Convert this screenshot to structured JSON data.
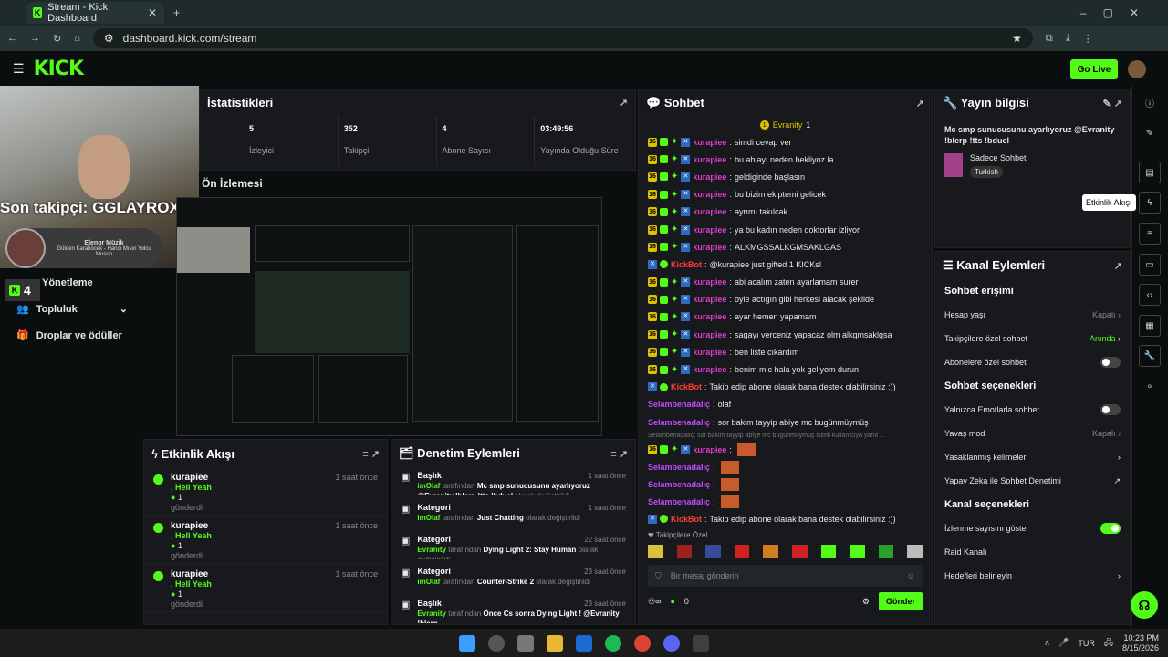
{
  "browser": {
    "tab_title": "Stream - Kick Dashboard",
    "url": "dashboard.kick.com/stream"
  },
  "header": {
    "logo": "KICK",
    "go_live": "Go Live"
  },
  "overlay": {
    "last_follower": "Son takipçi: GGLAYROX",
    "music_title": "Elenor Müzik",
    "music_artist": "Gülden Karaböcek - Hancı Mısın Yolcu Musun",
    "viewers": "4"
  },
  "sidebar": {
    "items": [
      {
        "label": "Yönetleme"
      },
      {
        "label": "Topluluk"
      },
      {
        "label": "Droplar ve ödüller"
      }
    ]
  },
  "stats": {
    "title": "İstatistikleri",
    "items": [
      {
        "value": "5",
        "label": "İzleyici"
      },
      {
        "value": "352",
        "label": "Takipçi"
      },
      {
        "value": "4",
        "label": "Abone Sayısı"
      },
      {
        "value": "03:49:56",
        "label": "Yayında Olduğu Süre"
      }
    ]
  },
  "preview": {
    "title": "Ön İzlemesi"
  },
  "chat": {
    "title": "Sohbet",
    "pinned_user": "Evranity",
    "pinned_count": "1",
    "lines": [
      {
        "user": "kurapiee",
        "text": "simdi cevap ver",
        "badges": true
      },
      {
        "user": "kurapiee",
        "text": "bu ablayı neden bekliyoz la",
        "badges": true
      },
      {
        "user": "kurapiee",
        "text": "geldiginde başlasın",
        "badges": true
      },
      {
        "user": "kurapiee",
        "text": "bu bizim ekiptemi gelicek",
        "badges": true
      },
      {
        "user": "kurapiee",
        "text": "ayrımı takılcak",
        "badges": true
      },
      {
        "user": "kurapiee",
        "text": "ya bu kadın neden doktorlar izliyor",
        "badges": true
      },
      {
        "user": "kurapiee",
        "text": "ALKMGSSALKGMSAKLGAS",
        "badges": true
      },
      {
        "user": "KickBot",
        "text": "@kurapiee just gifted 1 KICKs!",
        "badges": false
      },
      {
        "user": "kurapiee",
        "text": "abi acalım zaten ayarlamam surer",
        "badges": true
      },
      {
        "user": "kurapiee",
        "text": "oyle actıgın gibi herkesi alacak şekilde",
        "badges": true
      },
      {
        "user": "kurapiee",
        "text": "ayar hemen yapamam",
        "badges": true
      },
      {
        "user": "kurapiee",
        "text": "sagayı verceniz yapacaz olm alkgmsaklgsa",
        "badges": true
      },
      {
        "user": "kurapiee",
        "text": "ben liste cıkardım",
        "badges": true
      },
      {
        "user": "kurapiee",
        "text": "benim mic hala yok geliyom durun",
        "badges": true
      },
      {
        "user": "KickBot",
        "text": "Takip edip abone olarak bana destek olabilirsiniz :))",
        "badges": false
      },
      {
        "user": "Selambenadalıç",
        "text": "olaf",
        "badges": false
      },
      {
        "user": "Selambenadalıç",
        "text": "sor bakim tayyip abiye mc bugünmüymüş",
        "badges": false
      }
    ],
    "reply_hint": "Selambenadalıç: sor bakim tayyip abiye mc bugünmüymüş isimli kullanıcıya yanıt ...",
    "lines2": [
      {
        "user": "kurapiee",
        "text": "",
        "badges": true
      },
      {
        "user": "Selambenadalıç",
        "text": "",
        "badges": false
      },
      {
        "user": "Selambenadalıç",
        "text": "",
        "badges": false
      },
      {
        "user": "Selambenadalıç",
        "text": "",
        "badges": false
      },
      {
        "user": "KickBot",
        "text": "Takip edip abone olarak bana destek olabilirsiniz :))",
        "badges": false
      }
    ],
    "followers_only": "Takipçilere Özel",
    "placeholder": "Bir mesaj gönderin",
    "count": "0",
    "send": "Gönder"
  },
  "stream_info": {
    "title": "Yayın bilgisi",
    "stream_title": "Mc smp sunucusunu ayarlıyoruz @Evranity !blerp !tts !bduel",
    "category": "Sadece Sohbet",
    "tag": "Turkish"
  },
  "channel_actions": {
    "title": "Kanal Eylemleri",
    "chat_access": "Sohbet erişimi",
    "account_age": "Hesap yaşı",
    "account_age_value": "Kapalı",
    "followers_only": "Takipçilere özel sohbet",
    "followers_only_value": "Anında",
    "subs_only": "Abonelere özel sohbet",
    "chat_options": "Sohbet seçenekleri",
    "emote_only": "Yalnızca Emotlarla sohbet",
    "slow_mode": "Yavaş mod",
    "slow_mode_value": "Kapalı",
    "banned_words": "Yasaklanmış kelimeler",
    "ai_mod": "Yapay Zeka ile Sohbet Denetimi",
    "channel_options": "Kanal seçenekleri",
    "show_viewers": "İzlenme sayısını göster",
    "raid": "Raid Kanalı",
    "goals": "Hedefleri belirleyin"
  },
  "tooltip": "Etkinlik Akışı",
  "activity": {
    "title": "Etkinlik Akışı",
    "items": [
      {
        "user": "kurapiee",
        "msg": ", Hell Yeah",
        "amount": "1",
        "verb": "gönderdi",
        "time": "1 saat önce"
      },
      {
        "user": "kurapiee",
        "msg": ", Hell Yeah",
        "amount": "1",
        "verb": "gönderdi",
        "time": "1 saat önce"
      },
      {
        "user": "kurapiee",
        "msg": ", Hell Yeah",
        "amount": "1",
        "verb": "gönderdi",
        "time": "1 saat önce"
      }
    ]
  },
  "moderation": {
    "title": "Denetim Eylemleri",
    "items": [
      {
        "type": "Başlık",
        "time": "1 saat önce",
        "actor": "imOlaf",
        "by": "tarafından",
        "value": "Mc smp sunucusunu ayarlıyoruz @Evranity !blerp !tts !bduel",
        "suffix": "olarak değiştirildi"
      },
      {
        "type": "Kategori",
        "time": "1 saat önce",
        "actor": "imOlaf",
        "by": "tarafından",
        "value": "Just Chatting",
        "suffix": "olarak değiştirildi"
      },
      {
        "type": "Kategori",
        "time": "22 saat önce",
        "actor": "Evranity",
        "by": "tarafından",
        "value": "Dying Light 2: Stay Human",
        "suffix": "olarak değiştirildi"
      },
      {
        "type": "Kategori",
        "time": "23 saat önce",
        "actor": "imOlaf",
        "by": "tarafından",
        "value": "Counter-Strike 2",
        "suffix": "olarak değiştirildi"
      },
      {
        "type": "Başlık",
        "time": "23 saat önce",
        "actor": "Evranity",
        "by": "tarafından",
        "value": "Önce Cs sonra Dying Light ! @Evranity !blerp",
        "suffix": ""
      }
    ]
  },
  "taskbar": {
    "lang": "TUR",
    "time": "10:23 PM",
    "date": "8/15/2026"
  },
  "colors": {
    "accent": "#53fc18",
    "username": "#e23cc9",
    "panel": "#17191c"
  }
}
